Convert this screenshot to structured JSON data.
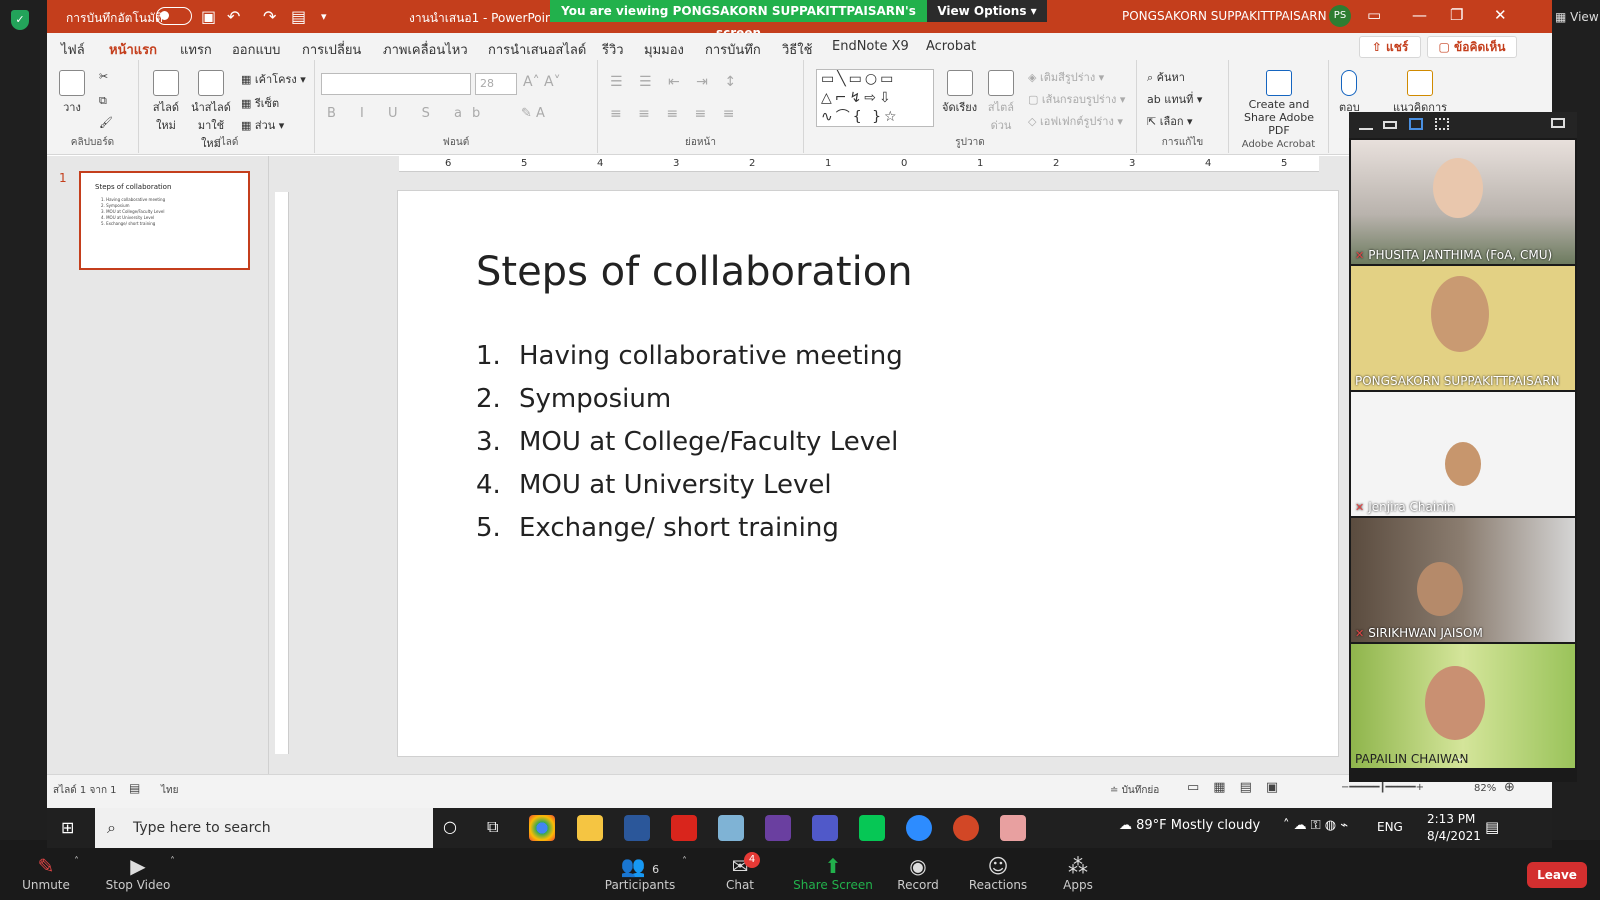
{
  "window": {
    "autosave_label": "การบันทึกอัตโนมัติ",
    "doc_title": "งานนำเสนอ1 - PowerPoint",
    "user_name": "PONGSAKORN SUPPAKITTPAISARN",
    "user_initials": "PS"
  },
  "zoom_banner": {
    "text": "You are viewing PONGSAKORN SUPPAKITTPAISARN's screen",
    "view_options": "View Options",
    "view_label": "View"
  },
  "tabs": [
    "ไฟล์",
    "หน้าแรก",
    "แทรก",
    "ออกแบบ",
    "การเปลี่ยน",
    "ภาพเคลื่อนไหว",
    "การนำเสนอสไลด์",
    "รีวิว",
    "มุมมอง",
    "การบันทึก",
    "วิธีใช้",
    "EndNote X9",
    "Acrobat"
  ],
  "share_btn": "แชร์",
  "comment_btn": "ข้อคิดเห็น",
  "ribbon": {
    "clipboard": {
      "label": "คลิปบอร์ด",
      "paste": "วาง"
    },
    "slides": {
      "label": "สไลด์",
      "new_slide": "สไลด์ ใหม่",
      "reuse": "นำสไลด์ มาใช้ใหม่",
      "layout": "เค้าโครง",
      "reset": "รีเซ็ต",
      "section": "ส่วน"
    },
    "font": {
      "label": "ฟอนต์",
      "size": "28"
    },
    "paragraph": {
      "label": "ย่อหน้า"
    },
    "drawing": {
      "label": "รูปวาด",
      "arrange": "จัดเรียง",
      "quick_styles": "สไตล์ ด่วน",
      "fill": "เติมสีรูปร่าง",
      "outline": "เส้นกรอบรูปร่าง",
      "effects": "เอฟเฟกต์รูปร่าง"
    },
    "editing": {
      "label": "การแก้ไข",
      "find": "ค้นหา",
      "replace": "แทนที่",
      "select": "เลือก"
    },
    "acrobat": {
      "label": "Adobe Acrobat",
      "create": "Create and Share Adobe PDF"
    },
    "dictate": "ตอบ",
    "ideas": "แนวคิดการ"
  },
  "slide": {
    "number": "1",
    "title": "Steps of collaboration",
    "items": [
      "Having collaborative meeting",
      "Symposium",
      "MOU at College/Faculty Level",
      "MOU at University Level",
      "Exchange/ short training"
    ]
  },
  "ruler": [
    "6",
    "5",
    "4",
    "3",
    "2",
    "1",
    "0",
    "1",
    "2",
    "3",
    "4",
    "5"
  ],
  "status": {
    "slide_of": "สไลด์ 1 จาก 1",
    "language": "ไทย",
    "notes": "บันทึกย่อ",
    "zoom": "82%"
  },
  "participants": [
    {
      "name": "PHUSITA JANTHIMA (FoA, CMU)",
      "muted": true
    },
    {
      "name": "PONGSAKORN SUPPAKITTPAISARN",
      "muted": false
    },
    {
      "name": "Jenjira Chainin",
      "muted": true
    },
    {
      "name": "SIRIKHWAN JAISOM",
      "muted": true
    },
    {
      "name": "PAPAILIN CHAIWAN",
      "muted": false
    }
  ],
  "taskbar": {
    "search_placeholder": "Type here to search",
    "weather": "89°F  Mostly cloudy",
    "lang": "ENG",
    "time": "2:13 PM",
    "date": "8/4/2021"
  },
  "zoom_controls": {
    "unmute": "Unmute",
    "stop_video": "Stop Video",
    "participants": "Participants",
    "participants_count": "6",
    "chat": "Chat",
    "chat_badge": "4",
    "share_screen": "Share Screen",
    "record": "Record",
    "reactions": "Reactions",
    "apps": "Apps",
    "leave": "Leave"
  },
  "colors": {
    "ppt_accent": "#c43e1c",
    "zoom_green": "#22b14c",
    "leave_red": "#d32f2f"
  }
}
